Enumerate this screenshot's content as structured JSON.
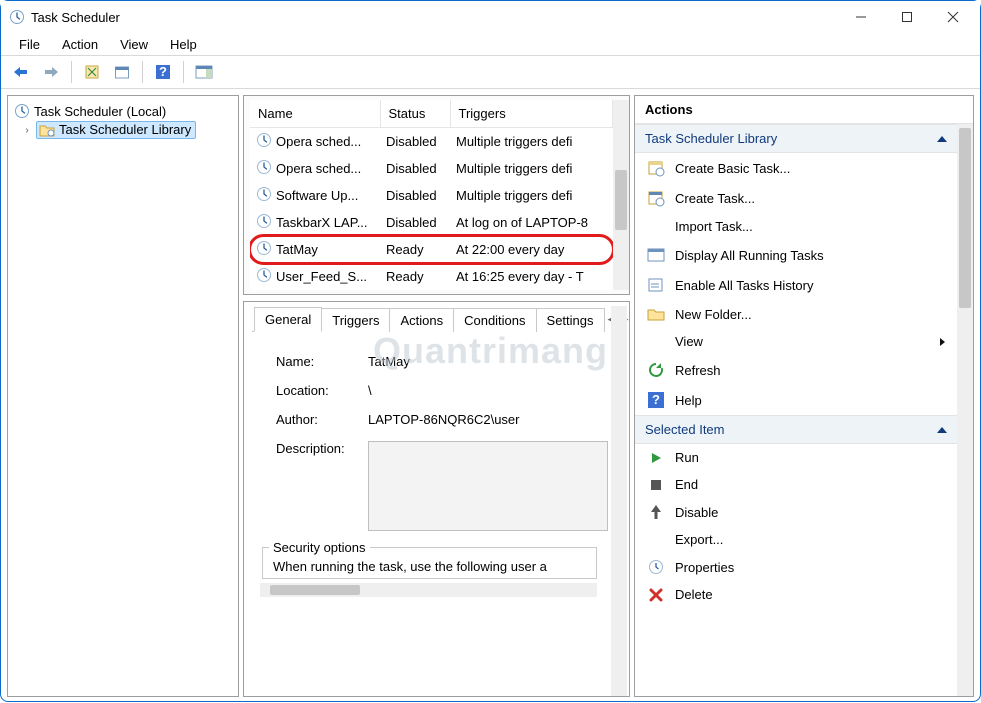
{
  "title": "Task Scheduler",
  "menu": {
    "file": "File",
    "action": "Action",
    "view": "View",
    "help": "Help"
  },
  "tree": {
    "root": "Task Scheduler (Local)",
    "library": "Task Scheduler Library"
  },
  "columns": {
    "name": "Name",
    "status": "Status",
    "triggers": "Triggers"
  },
  "tasks": [
    {
      "name": "Opera sched...",
      "status": "Disabled",
      "triggers": "Multiple triggers defi"
    },
    {
      "name": "Opera sched...",
      "status": "Disabled",
      "triggers": "Multiple triggers defi"
    },
    {
      "name": "Software Up...",
      "status": "Disabled",
      "triggers": "Multiple triggers defi"
    },
    {
      "name": "TaskbarX LAP...",
      "status": "Disabled",
      "triggers": "At log on of LAPTOP-8"
    },
    {
      "name": "TatMay",
      "status": "Ready",
      "triggers": "At 22:00 every day",
      "highlight": true
    },
    {
      "name": "User_Feed_S...",
      "status": "Ready",
      "triggers": "At 16:25 every day - T"
    }
  ],
  "detail_tabs": {
    "general": "General",
    "triggers": "Triggers",
    "actions": "Actions",
    "conditions": "Conditions",
    "settings": "Settings"
  },
  "detail": {
    "name_label": "Name:",
    "name_value": "TatMay",
    "location_label": "Location:",
    "location_value": "\\",
    "author_label": "Author:",
    "author_value": "LAPTOP-86NQR6C2\\user",
    "desc_label": "Description:",
    "secopts_legend": "Security options",
    "secopts_text": "When running the task, use the following user a"
  },
  "actions_pane": {
    "header": "Actions",
    "section1": "Task Scheduler Library",
    "items1": [
      {
        "k": "create-basic",
        "label": "Create Basic Task..."
      },
      {
        "k": "create-task",
        "label": "Create Task..."
      },
      {
        "k": "import-task",
        "label": "Import Task..."
      },
      {
        "k": "display-running",
        "label": "Display All Running Tasks"
      },
      {
        "k": "enable-history",
        "label": "Enable All Tasks History"
      },
      {
        "k": "new-folder",
        "label": "New Folder..."
      },
      {
        "k": "view",
        "label": "View",
        "submenu": true
      },
      {
        "k": "refresh",
        "label": "Refresh"
      },
      {
        "k": "help",
        "label": "Help"
      }
    ],
    "section2": "Selected Item",
    "items2": [
      {
        "k": "run",
        "label": "Run"
      },
      {
        "k": "end",
        "label": "End"
      },
      {
        "k": "disable",
        "label": "Disable"
      },
      {
        "k": "export",
        "label": "Export..."
      },
      {
        "k": "properties",
        "label": "Properties"
      },
      {
        "k": "delete",
        "label": "Delete"
      }
    ]
  },
  "watermark": "Quantrimang"
}
